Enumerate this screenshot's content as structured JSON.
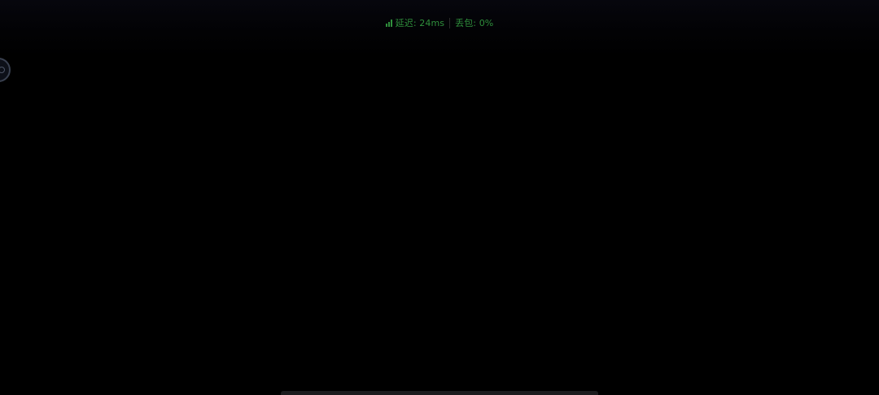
{
  "status_bar": {
    "latency_label": "延迟: 24ms",
    "packet_loss_label": "丢包: 0%",
    "signal_icon": "signal-bars-icon",
    "color": "#2f8f3c"
  },
  "floating_button": {
    "icon": "assistive-touch-icon"
  },
  "background_color": "#000000"
}
